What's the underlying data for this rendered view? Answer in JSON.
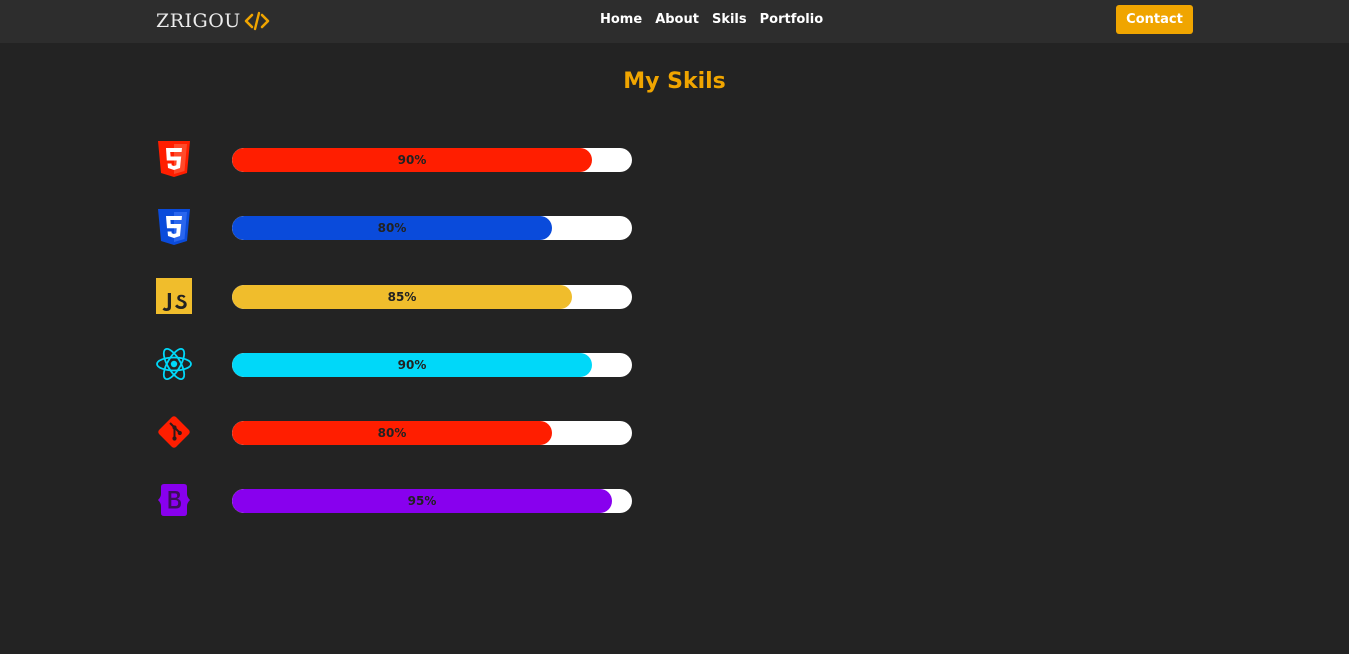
{
  "header": {
    "logo_text": "ZRIGOU",
    "logo_icon": "code-icon",
    "nav": [
      {
        "label": "Home"
      },
      {
        "label": "About"
      },
      {
        "label": "Skils"
      },
      {
        "label": "Portfolio"
      }
    ],
    "contact_label": "Contact"
  },
  "colors": {
    "accent": "#f0a500",
    "background": "#232323",
    "navbar": "#2d2d2d"
  },
  "skills": {
    "title": "My Skils",
    "items": [
      {
        "icon": "html5-icon",
        "percent": 90,
        "label": "90%",
        "color": "#ff1e00"
      },
      {
        "icon": "css3-icon",
        "percent": 80,
        "label": "80%",
        "color": "#0a4bdb"
      },
      {
        "icon": "javascript-icon",
        "percent": 85,
        "label": "85%",
        "color": "#f0bd2c"
      },
      {
        "icon": "react-icon",
        "percent": 90,
        "label": "90%",
        "color": "#00d8f9"
      },
      {
        "icon": "git-icon",
        "percent": 80,
        "label": "80%",
        "color": "#ff1e00"
      },
      {
        "icon": "bootstrap-icon",
        "percent": 95,
        "label": "95%",
        "color": "#8800ee"
      }
    ]
  }
}
